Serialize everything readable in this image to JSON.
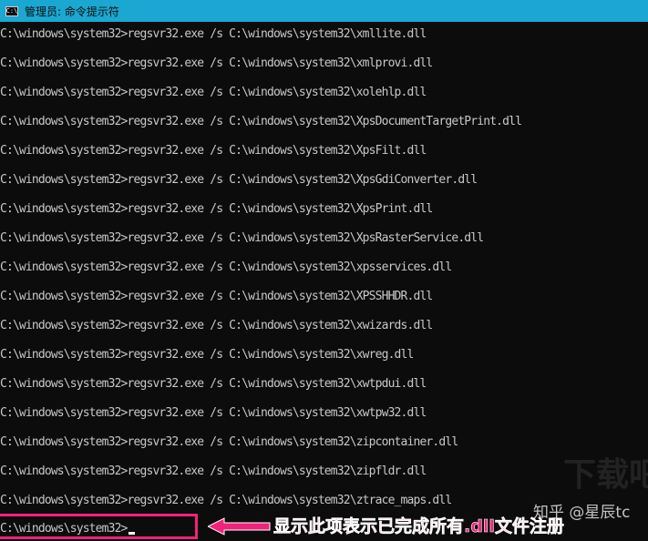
{
  "window": {
    "title": "管理员: 命令提示符",
    "icon": "console-icon",
    "icon_glyph": "C:\\"
  },
  "console": {
    "lines": [
      "C:\\windows\\system32>regsvr32.exe /s C:\\windows\\system32\\xmllite.dll",
      "C:\\windows\\system32>regsvr32.exe /s C:\\windows\\system32\\xmlprovi.dll",
      "C:\\windows\\system32>regsvr32.exe /s C:\\windows\\system32\\xolehlp.dll",
      "C:\\windows\\system32>regsvr32.exe /s C:\\windows\\system32\\XpsDocumentTargetPrint.dll",
      "C:\\windows\\system32>regsvr32.exe /s C:\\windows\\system32\\XpsFilt.dll",
      "C:\\windows\\system32>regsvr32.exe /s C:\\windows\\system32\\XpsGdiConverter.dll",
      "C:\\windows\\system32>regsvr32.exe /s C:\\windows\\system32\\XpsPrint.dll",
      "C:\\windows\\system32>regsvr32.exe /s C:\\windows\\system32\\XpsRasterService.dll",
      "C:\\windows\\system32>regsvr32.exe /s C:\\windows\\system32\\xpsservices.dll",
      "C:\\windows\\system32>regsvr32.exe /s C:\\windows\\system32\\XPSSHHDR.dll",
      "C:\\windows\\system32>regsvr32.exe /s C:\\windows\\system32\\xwizards.dll",
      "C:\\windows\\system32>regsvr32.exe /s C:\\windows\\system32\\xwreg.dll",
      "C:\\windows\\system32>regsvr32.exe /s C:\\windows\\system32\\xwtpdui.dll",
      "C:\\windows\\system32>regsvr32.exe /s C:\\windows\\system32\\xwtpw32.dll",
      "C:\\windows\\system32>regsvr32.exe /s C:\\windows\\system32\\zipcontainer.dll",
      "C:\\windows\\system32>regsvr32.exe /s C:\\windows\\system32\\zipfldr.dll",
      "C:\\windows\\system32>regsvr32.exe /s C:\\windows\\system32\\ztrace_maps.dll"
    ],
    "prompt": "C:\\windows\\system32>"
  },
  "annotation": {
    "text": "显示此项表示已完成所有.dll文件注册",
    "color": "#f0237a"
  },
  "watermark": {
    "zhihu": "知乎 @星辰tc",
    "logo": "下载吧"
  },
  "colors": {
    "titlebar": "#1aa7d1",
    "console_bg": "#0c0c0c",
    "console_text": "#c8c8c8",
    "highlight": "#f0237a"
  }
}
